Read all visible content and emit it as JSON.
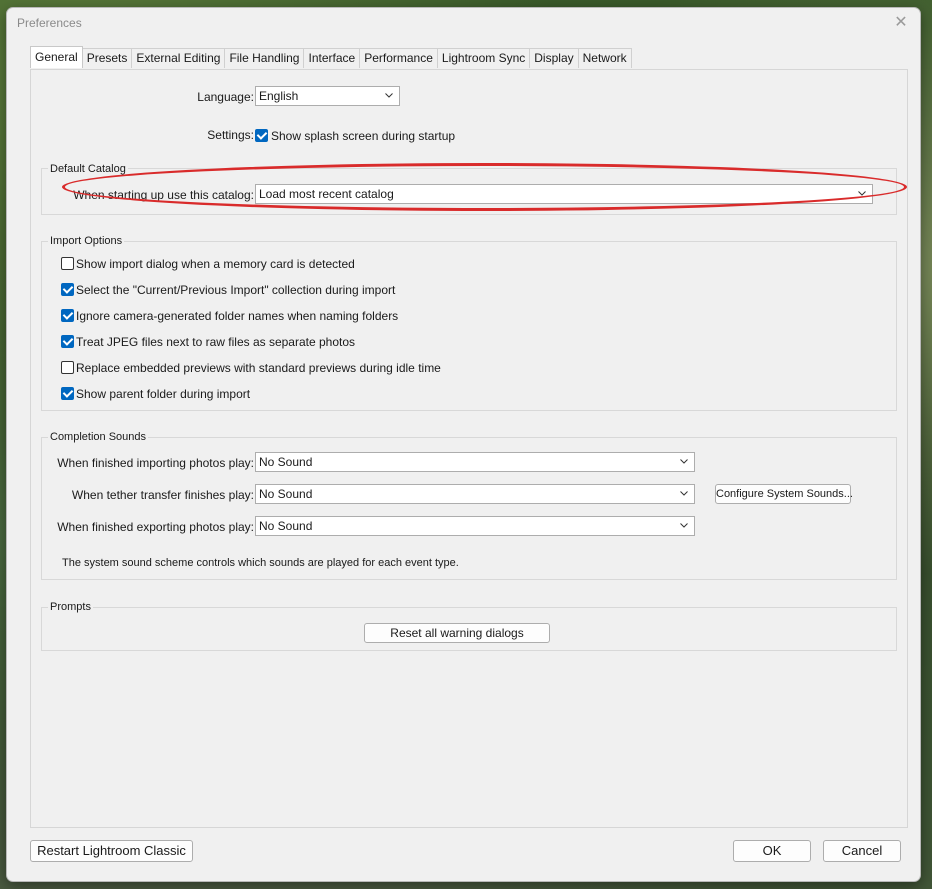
{
  "window": {
    "title": "Preferences"
  },
  "tabs": [
    "General",
    "Presets",
    "External Editing",
    "File Handling",
    "Interface",
    "Performance",
    "Lightroom Sync",
    "Display",
    "Network"
  ],
  "general": {
    "language_label": "Language:",
    "language_value": "English",
    "settings_label": "Settings:",
    "splash_label": "Show splash screen during startup",
    "splash_checked": true
  },
  "default_catalog": {
    "title": "Default Catalog",
    "label": "When starting up use this catalog:",
    "value": "Load most recent catalog"
  },
  "import_options": {
    "title": "Import Options",
    "items": [
      {
        "label": "Show import dialog when a memory card is detected",
        "checked": false
      },
      {
        "label": "Select the \"Current/Previous Import\" collection during import",
        "checked": true
      },
      {
        "label": "Ignore camera-generated folder names when naming folders",
        "checked": true
      },
      {
        "label": "Treat JPEG files next to raw files as separate photos",
        "checked": true
      },
      {
        "label": "Replace embedded previews with standard previews during idle time",
        "checked": false
      },
      {
        "label": "Show parent folder during import",
        "checked": true
      }
    ]
  },
  "completion_sounds": {
    "title": "Completion Sounds",
    "importing_label": "When finished importing photos play:",
    "importing_value": "No Sound",
    "tether_label": "When tether transfer finishes play:",
    "tether_value": "No Sound",
    "exporting_label": "When finished exporting photos play:",
    "exporting_value": "No Sound",
    "configure_button": "Configure System Sounds...",
    "note": "The system sound scheme controls which sounds are played for each event type."
  },
  "prompts": {
    "title": "Prompts",
    "reset_button": "Reset all warning dialogs"
  },
  "footer": {
    "restart_button": "Restart Lightroom Classic",
    "ok_button": "OK",
    "cancel_button": "Cancel"
  },
  "annotation": {
    "oval_color": "#d92b2b"
  }
}
